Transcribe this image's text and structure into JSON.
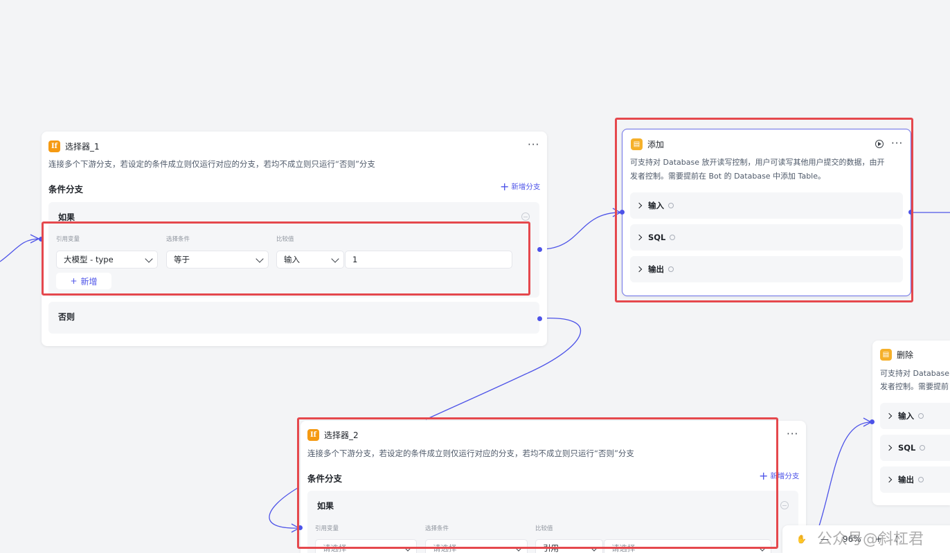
{
  "selector1": {
    "title": "选择器_1",
    "badge": "If",
    "description": "连接多个下游分支，若设定的条件成立则仅运行对应的分支，若均不成立则只运行“否则”分支",
    "section_title": "条件分支",
    "add_branch_label": "新增分支",
    "if_label": "如果",
    "col_variable": "引用变量",
    "col_condition": "选择条件",
    "col_compare": "比较值",
    "variable_value": "大模型 - type",
    "condition_value": "等于",
    "compare_type": "输入",
    "compare_value": "1",
    "add_label": "新增",
    "else_label": "否则"
  },
  "add_node": {
    "title": "添加",
    "description_line1": "可支持对 Database 放开读写控制，用户可读写其他用户提交的数据，由开",
    "description_line2": "发者控制。需要提前在 Bot 的 Database 中添加 Table。",
    "rows": [
      "输入",
      "SQL",
      "输出"
    ]
  },
  "delete_node": {
    "title": "删除",
    "description_line1": "可支持对 Database",
    "description_line2": "发者控制。需要提前",
    "rows": [
      "输入",
      "SQL",
      "输出"
    ]
  },
  "selector2": {
    "title": "选择器_2",
    "badge": "If",
    "description": "连接多个下游分支，若设定的条件成立则仅运行对应的分支，若均不成立则只运行“否则”分支",
    "section_title": "条件分支",
    "add_branch_label": "新增分支",
    "if_label": "如果",
    "col_variable": "引用变量",
    "col_condition": "选择条件",
    "col_compare": "比较值",
    "variable_placeholder": "请选择",
    "condition_placeholder": "请选择",
    "compare_type": "引用",
    "compare_placeholder": "请选择"
  },
  "toolbar": {
    "zoom": "96%",
    "minus": "—",
    "plus": "+"
  },
  "watermark": "公众号@斜杠君"
}
